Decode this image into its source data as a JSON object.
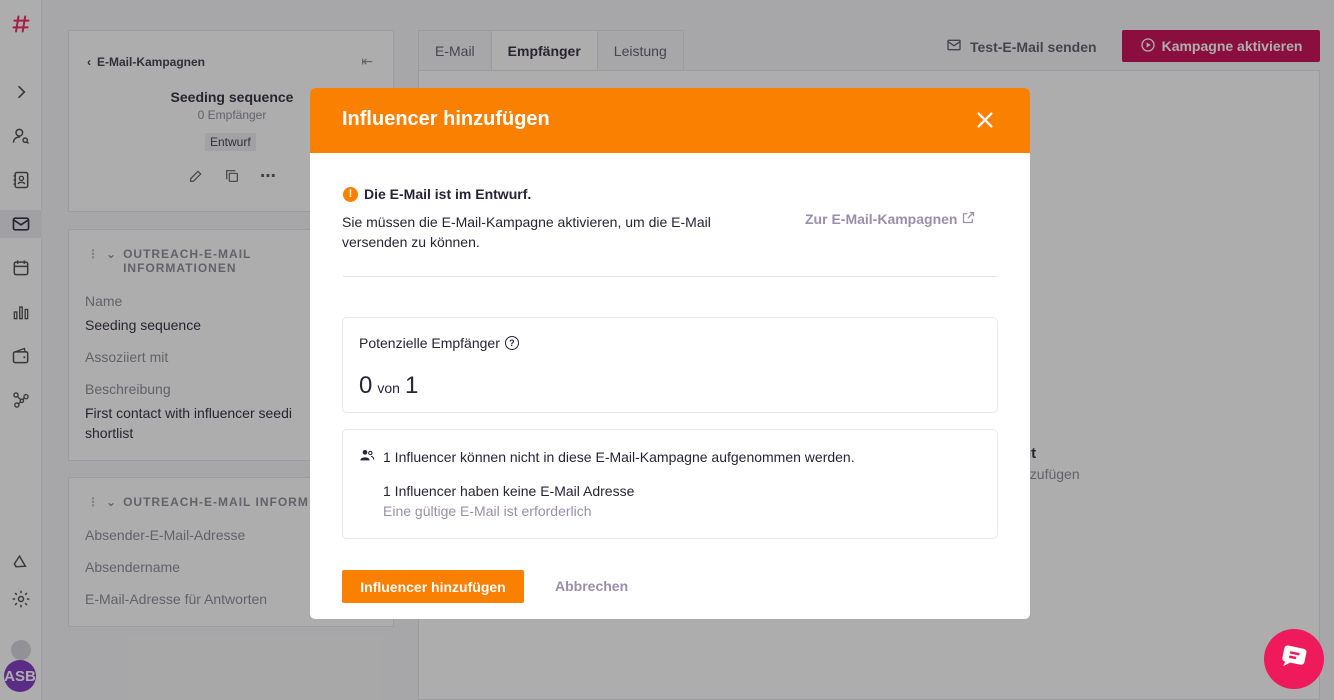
{
  "sidebar_left": {
    "avatar_initials": "ASB"
  },
  "campaign_panel": {
    "back_label": "E-Mail-Kampagnen",
    "title": "Seeding sequence",
    "recipients": "0 Empfänger",
    "status_badge": "Entwurf"
  },
  "info_section": {
    "heading": "OUTREACH-E-MAIL INFORMATIONEN",
    "name_label": "Name",
    "name_value": "Seeding sequence",
    "associated_label": "Assoziiert mit",
    "description_label": "Beschreibung",
    "description_value_line1": "First contact with influencer seedi",
    "description_value_line2": "shortlist"
  },
  "sender_section": {
    "heading": "OUTREACH-E-MAIL INFORM",
    "sender_email_label": "Absender-E-Mail-Adresse",
    "sender_name_label": "Absendername",
    "reply_email_label": "E-Mail-Adresse für Antworten"
  },
  "tabs": [
    {
      "label": "E-Mail"
    },
    {
      "label": "Empfänger"
    },
    {
      "label": "Leistung"
    }
  ],
  "toolbar": {
    "test_email_label": "Test-E-Mail senden",
    "activate_label": "Kampagne aktivieren"
  },
  "background_fragments": {
    "line1": "gt",
    "line2": "nzufügen"
  },
  "modal": {
    "title": "Influencer hinzufügen",
    "warning_title": "Die E-Mail ist im Entwurf.",
    "warning_text": "Sie müssen die E-Mail-Kampagne aktivieren, um die E-Mail versenden zu können.",
    "campaign_link": "Zur E-Mail-Kampagnen",
    "potential_label": "Potenzielle Empfänger",
    "count_current": "0",
    "count_of": "von",
    "count_total": "1",
    "excluded_text": "1 Influencer können nicht in diese E-Mail-Kampagne aufgenommen werden.",
    "no_email_text": "1 Influencer haben keine E-Mail Adresse",
    "email_required_text": "Eine gültige E-Mail ist erforderlich",
    "add_button": "Influencer hinzufügen",
    "cancel_button": "Abbrechen"
  },
  "colors": {
    "accent_orange": "#f98000",
    "brand_red": "#c8004d",
    "chat_pink": "#ef1a5c",
    "avatar_purple": "#7b2fbe"
  },
  "icons": [
    "hashtag-logo-icon",
    "chevron-right-icon",
    "user-search-icon",
    "contacts-icon",
    "mail-icon",
    "calendar-icon",
    "bar-chart-icon",
    "wallet-icon",
    "network-icon",
    "megaphone-icon",
    "gear-icon",
    "close-icon",
    "warning-icon",
    "external-link-icon",
    "help-icon",
    "users-icon",
    "chat-icon"
  ]
}
